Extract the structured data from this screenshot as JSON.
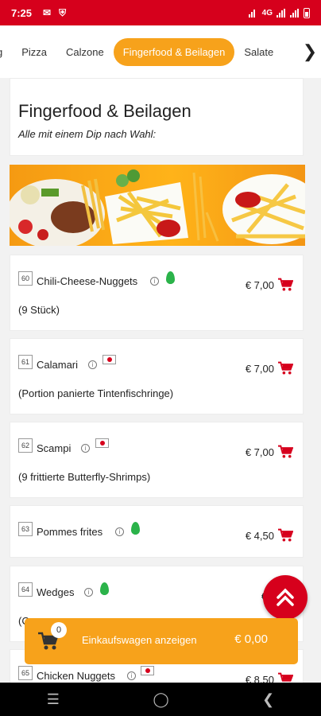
{
  "status": {
    "time": "7:25",
    "network": "4G"
  },
  "tabs": [
    {
      "label": "g"
    },
    {
      "label": "Pizza"
    },
    {
      "label": "Calzone"
    },
    {
      "label": "Fingerfood & Beilagen"
    },
    {
      "label": "Salate"
    }
  ],
  "category": {
    "title": "Fingerfood & Beilagen",
    "subtitle": "Alle mit einem Dip nach Wahl:"
  },
  "items": [
    {
      "number": "60",
      "name": "Chili-Cheese-Nuggets",
      "desc": "(9 Stück)",
      "price": "€ 7,00"
    },
    {
      "number": "61",
      "name": "Calamari",
      "desc": "(Portion panierte Tintenfischringe)",
      "price": "€ 7,00"
    },
    {
      "number": "62",
      "name": "Scampi",
      "desc": "(9 frittierte Butterfly-Shrimps)",
      "price": "€ 7,00"
    },
    {
      "number": "63",
      "name": "Pommes frites",
      "desc": "",
      "price": "€ 4,50"
    },
    {
      "number": "64",
      "name": "Wedges",
      "desc": "(C",
      "price": "€ 5"
    },
    {
      "number": "65",
      "name": "Chicken Nuggets",
      "desc": "",
      "price": "€ 8,50"
    }
  ],
  "cart": {
    "count": "0",
    "label": "Einkaufswagen anzeigen",
    "total": "€ 0,00"
  },
  "colors": {
    "brand_red": "#d6001c",
    "accent_orange": "#f7a21b"
  }
}
